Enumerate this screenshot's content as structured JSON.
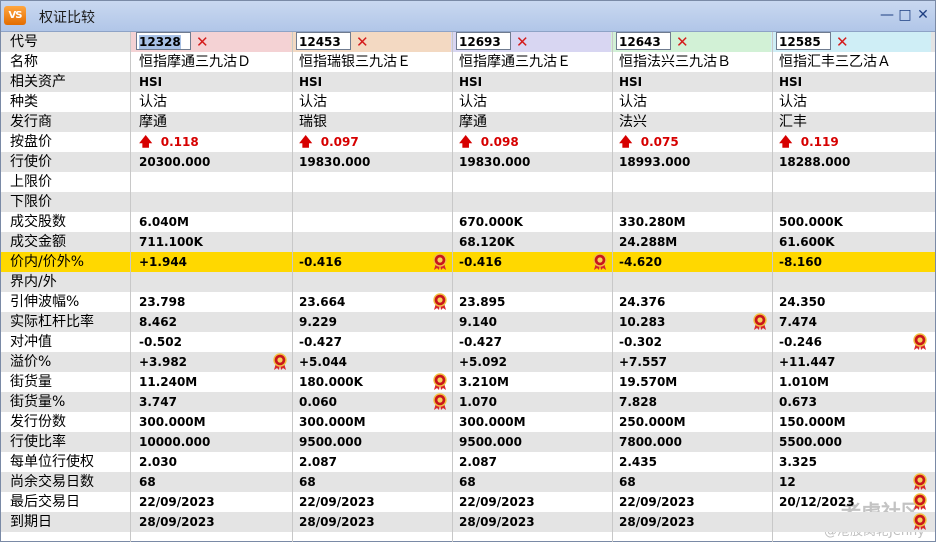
{
  "window": {
    "title": "权证比较",
    "app_icon": "VS"
  },
  "labels": [
    "代号",
    "名称",
    "相关资产",
    "种类",
    "发行商",
    "按盘价",
    "行使价",
    "上限价",
    "下限价",
    "成交股数",
    "成交金额",
    "价内/价外%",
    "界内/外",
    "引伸波幅%",
    "实际杠杆比率",
    "对冲值",
    "溢价%",
    "街货量",
    "街货量%",
    "发行份数",
    "行使比率",
    "每单位行使权",
    "尚余交易日数",
    "最后交易日",
    "到期日"
  ],
  "header_colors": [
    "#f4d2d4",
    "#f3d9c2",
    "#d8d6f2",
    "#d2f1d6",
    "#cfeef6"
  ],
  "warrants": [
    {
      "code": "12328",
      "name": "恒指摩通三九沽Ｄ",
      "asset": "HSI",
      "type": "认沽",
      "issuer": "摩通",
      "price": "0.118",
      "strike": "20300.000",
      "upper": "",
      "lower": "",
      "volume": "6.040M",
      "turnover": "711.100K",
      "moneyness": "+1.944",
      "range": "",
      "iv": "23.798",
      "leverage": "8.462",
      "delta": "-0.502",
      "premium": "+3.982",
      "outstanding": "11.240M",
      "outstanding_pct": "3.747",
      "issued": "300.000M",
      "ratio": "10000.000",
      "per_unit": "2.030",
      "days": "68",
      "last_trade": "22/09/2023",
      "expiry": "28/09/2023"
    },
    {
      "code": "12453",
      "name": "恒指瑞银三九沽Ｅ",
      "asset": "HSI",
      "type": "认沽",
      "issuer": "瑞银",
      "price": "0.097",
      "strike": "19830.000",
      "upper": "",
      "lower": "",
      "volume": "",
      "turnover": "",
      "moneyness": "-0.416",
      "range": "",
      "iv": "23.664",
      "leverage": "9.229",
      "delta": "-0.427",
      "premium": "+5.044",
      "outstanding": "180.000K",
      "outstanding_pct": "0.060",
      "issued": "300.000M",
      "ratio": "9500.000",
      "per_unit": "2.087",
      "days": "68",
      "last_trade": "22/09/2023",
      "expiry": "28/09/2023"
    },
    {
      "code": "12693",
      "name": "恒指摩通三九沽Ｅ",
      "asset": "HSI",
      "type": "认沽",
      "issuer": "摩通",
      "price": "0.098",
      "strike": "19830.000",
      "upper": "",
      "lower": "",
      "volume": "670.000K",
      "turnover": "68.120K",
      "moneyness": "-0.416",
      "range": "",
      "iv": "23.895",
      "leverage": "9.140",
      "delta": "-0.427",
      "premium": "+5.092",
      "outstanding": "3.210M",
      "outstanding_pct": "1.070",
      "issued": "300.000M",
      "ratio": "9500.000",
      "per_unit": "2.087",
      "days": "68",
      "last_trade": "22/09/2023",
      "expiry": "28/09/2023"
    },
    {
      "code": "12643",
      "name": "恒指法兴三九沽Ｂ",
      "asset": "HSI",
      "type": "认沽",
      "issuer": "法兴",
      "price": "0.075",
      "strike": "18993.000",
      "upper": "",
      "lower": "",
      "volume": "330.280M",
      "turnover": "24.288M",
      "moneyness": "-4.620",
      "range": "",
      "iv": "24.376",
      "leverage": "10.283",
      "delta": "-0.302",
      "premium": "+7.557",
      "outstanding": "19.570M",
      "outstanding_pct": "7.828",
      "issued": "250.000M",
      "ratio": "7800.000",
      "per_unit": "2.435",
      "days": "68",
      "last_trade": "22/09/2023",
      "expiry": "28/09/2023"
    },
    {
      "code": "12585",
      "name": "恒指汇丰三乙沽Ａ",
      "asset": "HSI",
      "type": "认沽",
      "issuer": "汇丰",
      "price": "0.119",
      "strike": "18288.000",
      "upper": "",
      "lower": "",
      "volume": "500.000K",
      "turnover": "61.600K",
      "moneyness": "-8.160",
      "range": "",
      "iv": "24.350",
      "leverage": "7.474",
      "delta": "-0.246",
      "premium": "+11.447",
      "outstanding": "1.010M",
      "outstanding_pct": "0.673",
      "issued": "150.000M",
      "ratio": "5500.000",
      "per_unit": "3.325",
      "days": "12",
      "last_trade": "20/12/2023",
      "expiry": ""
    }
  ],
  "watermark": {
    "line1": "老虎社区",
    "line2": "@港股窝轮Jenny"
  }
}
